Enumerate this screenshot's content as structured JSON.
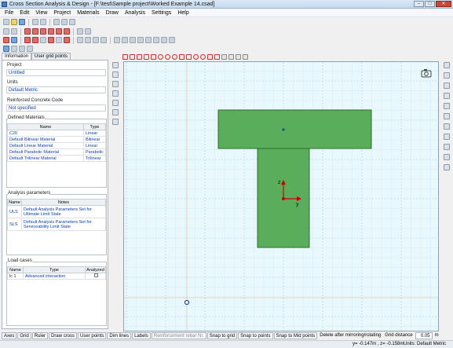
{
  "window": {
    "title": "Cross Section Analysis & Design - [F:\\test\\Sample project\\Worked Example 14.csad]"
  },
  "menu": [
    "File",
    "Edit",
    "View",
    "Project",
    "Materials",
    "Draw",
    "Analysis",
    "Settings",
    "Help"
  ],
  "tabs": [
    "Information",
    "User grid points"
  ],
  "info": {
    "project_label": "Project",
    "project_value": "Untitled",
    "units_label": "Units",
    "units_value": "Default Metric",
    "code_label": "Reinforced Concrete Code",
    "code_value": "Not specified"
  },
  "materials": {
    "title": "Defined Materials",
    "headers": [
      "Name",
      "Type"
    ],
    "rows": [
      {
        "name": "C20",
        "type": "Linear"
      },
      {
        "name": "Default Bilinear Material",
        "type": "Bilinear"
      },
      {
        "name": "Default Linear Material",
        "type": "Linear"
      },
      {
        "name": "Default Parabolic Material",
        "type": "Parabolic"
      },
      {
        "name": "Default Trilinear Material",
        "type": "Trilinear"
      }
    ]
  },
  "analysis": {
    "title": "Analysis parameters",
    "headers": [
      "Name",
      "Notes"
    ],
    "rows": [
      {
        "name": "ULS",
        "notes": "Default Analysis Parameters Set for Ultimate Limit State"
      },
      {
        "name": "SLS",
        "notes": "Default Analysis Parameters Set for Serviceability Limit State"
      }
    ]
  },
  "loadcases": {
    "title": "Load cases",
    "headers": [
      "Name",
      "Type",
      "Analyzed"
    ],
    "rows": [
      {
        "num": "lc 1",
        "type": "Advanced interaction",
        "analyzed": false
      }
    ]
  },
  "canvas": {
    "axis_y_label": "z",
    "axis_x_label": "y",
    "shape_color": "#5aad5a",
    "shape_border": "#2f6e2f",
    "bg_color": "#e9f8fd"
  },
  "status": {
    "buttons": [
      "Axes",
      "Grid",
      "Ruler",
      "Draw cross",
      "User points",
      "Dim lines",
      "Labels",
      "Reinforcement rebar Nr.",
      "Snap to grid",
      "Snap to points",
      "Snap to Mid points"
    ],
    "delete_after": "Delete after mirroring/rotating",
    "grid_distance_label": "Grid distance",
    "grid_distance_value": "0.05",
    "grid_distance_unit": "m"
  },
  "bottom": {
    "coords": "y= -0.147m , z= -0.158m",
    "units": "Units: Default Metric"
  }
}
